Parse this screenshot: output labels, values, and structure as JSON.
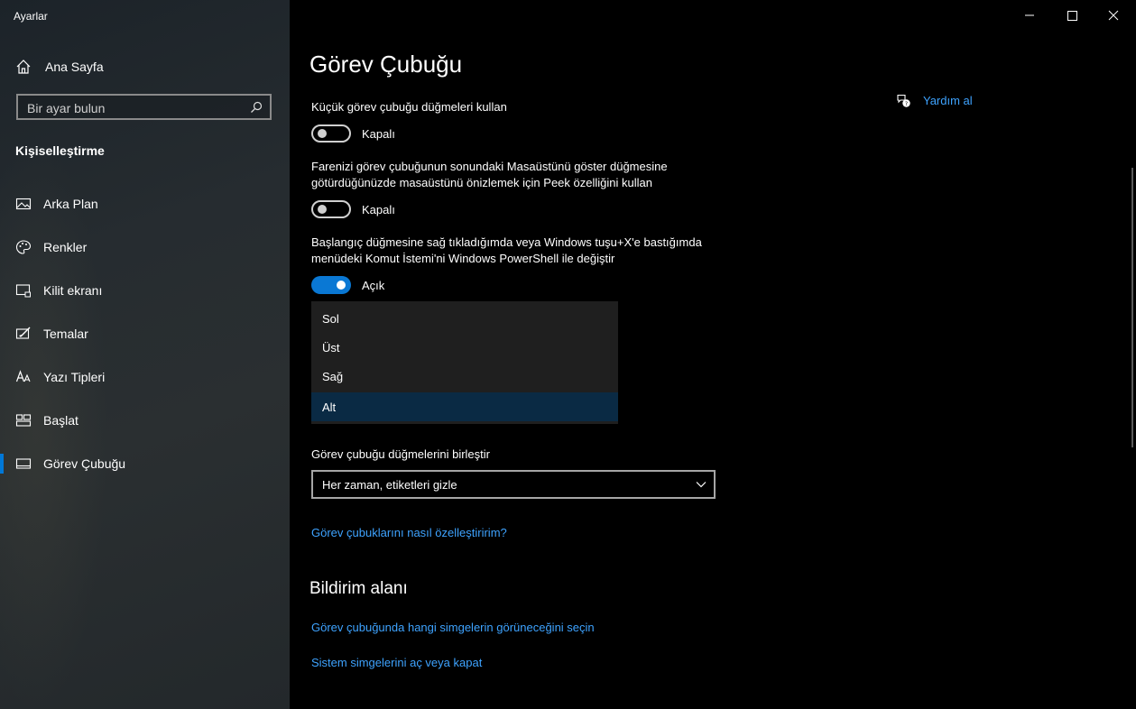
{
  "window": {
    "app_title": "Ayarlar"
  },
  "sidebar": {
    "home_label": "Ana Sayfa",
    "search_placeholder": "Bir ayar bulun",
    "section_title": "Kişiselleştirme",
    "items": [
      {
        "label": "Arka Plan",
        "icon": "picture-icon"
      },
      {
        "label": "Renkler",
        "icon": "palette-icon"
      },
      {
        "label": "Kilit ekranı",
        "icon": "lock-screen-icon"
      },
      {
        "label": "Temalar",
        "icon": "themes-icon"
      },
      {
        "label": "Yazı Tipleri",
        "icon": "fonts-icon"
      },
      {
        "label": "Başlat",
        "icon": "start-icon"
      },
      {
        "label": "Görev Çubuğu",
        "icon": "taskbar-icon",
        "active": true
      }
    ]
  },
  "main": {
    "title": "Görev Çubuğu",
    "help_label": "Yardım al",
    "options": [
      {
        "label": "Küçük görev çubuğu düğmeleri kullan",
        "state": "Kapalı",
        "on": false
      },
      {
        "label": "Farenizi görev çubuğunun sonundaki Masaüstünü göster düğmesine götürdüğünüzde masaüstünü önizlemek için Peek özelliğini kullan",
        "state": "Kapalı",
        "on": false
      },
      {
        "label": "Başlangıç düğmesine sağ tıkladığımda veya Windows tuşu+X'e bastığımda menüdeki Komut İstemi'ni Windows PowerShell ile değiştir",
        "state": "Açık",
        "on": true
      }
    ],
    "position_dropdown": {
      "options": [
        "Sol",
        "Üst",
        "Sağ",
        "Alt"
      ],
      "selected": "Alt"
    },
    "combine": {
      "label": "Görev çubuğu düğmelerini birleştir",
      "value": "Her zaman, etiketleri gizle"
    },
    "customize_link": "Görev çubuklarını nasıl özelleştiririm?",
    "notification_area": {
      "heading": "Bildirim alanı",
      "links": [
        "Görev çubuğunda hangi simgelerin görüneceğini seçin",
        "Sistem simgelerini aç veya kapat"
      ]
    }
  },
  "colors": {
    "accent": "#0078d7",
    "link": "#3ea3ff",
    "background": "#000000"
  }
}
